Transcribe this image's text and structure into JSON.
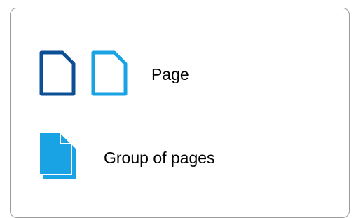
{
  "legend": {
    "items": [
      {
        "label": "Page",
        "icons": [
          "page-dark-icon",
          "page-light-icon"
        ]
      },
      {
        "label": "Group of pages",
        "icons": [
          "page-group-icon"
        ]
      }
    ]
  },
  "colors": {
    "page_dark": "#0c4f95",
    "page_light": "#1aa3e4",
    "group_back": "#1aa3e4",
    "group_front": "#1aa3e4",
    "border": "#9a9a9a",
    "text": "#000000"
  }
}
